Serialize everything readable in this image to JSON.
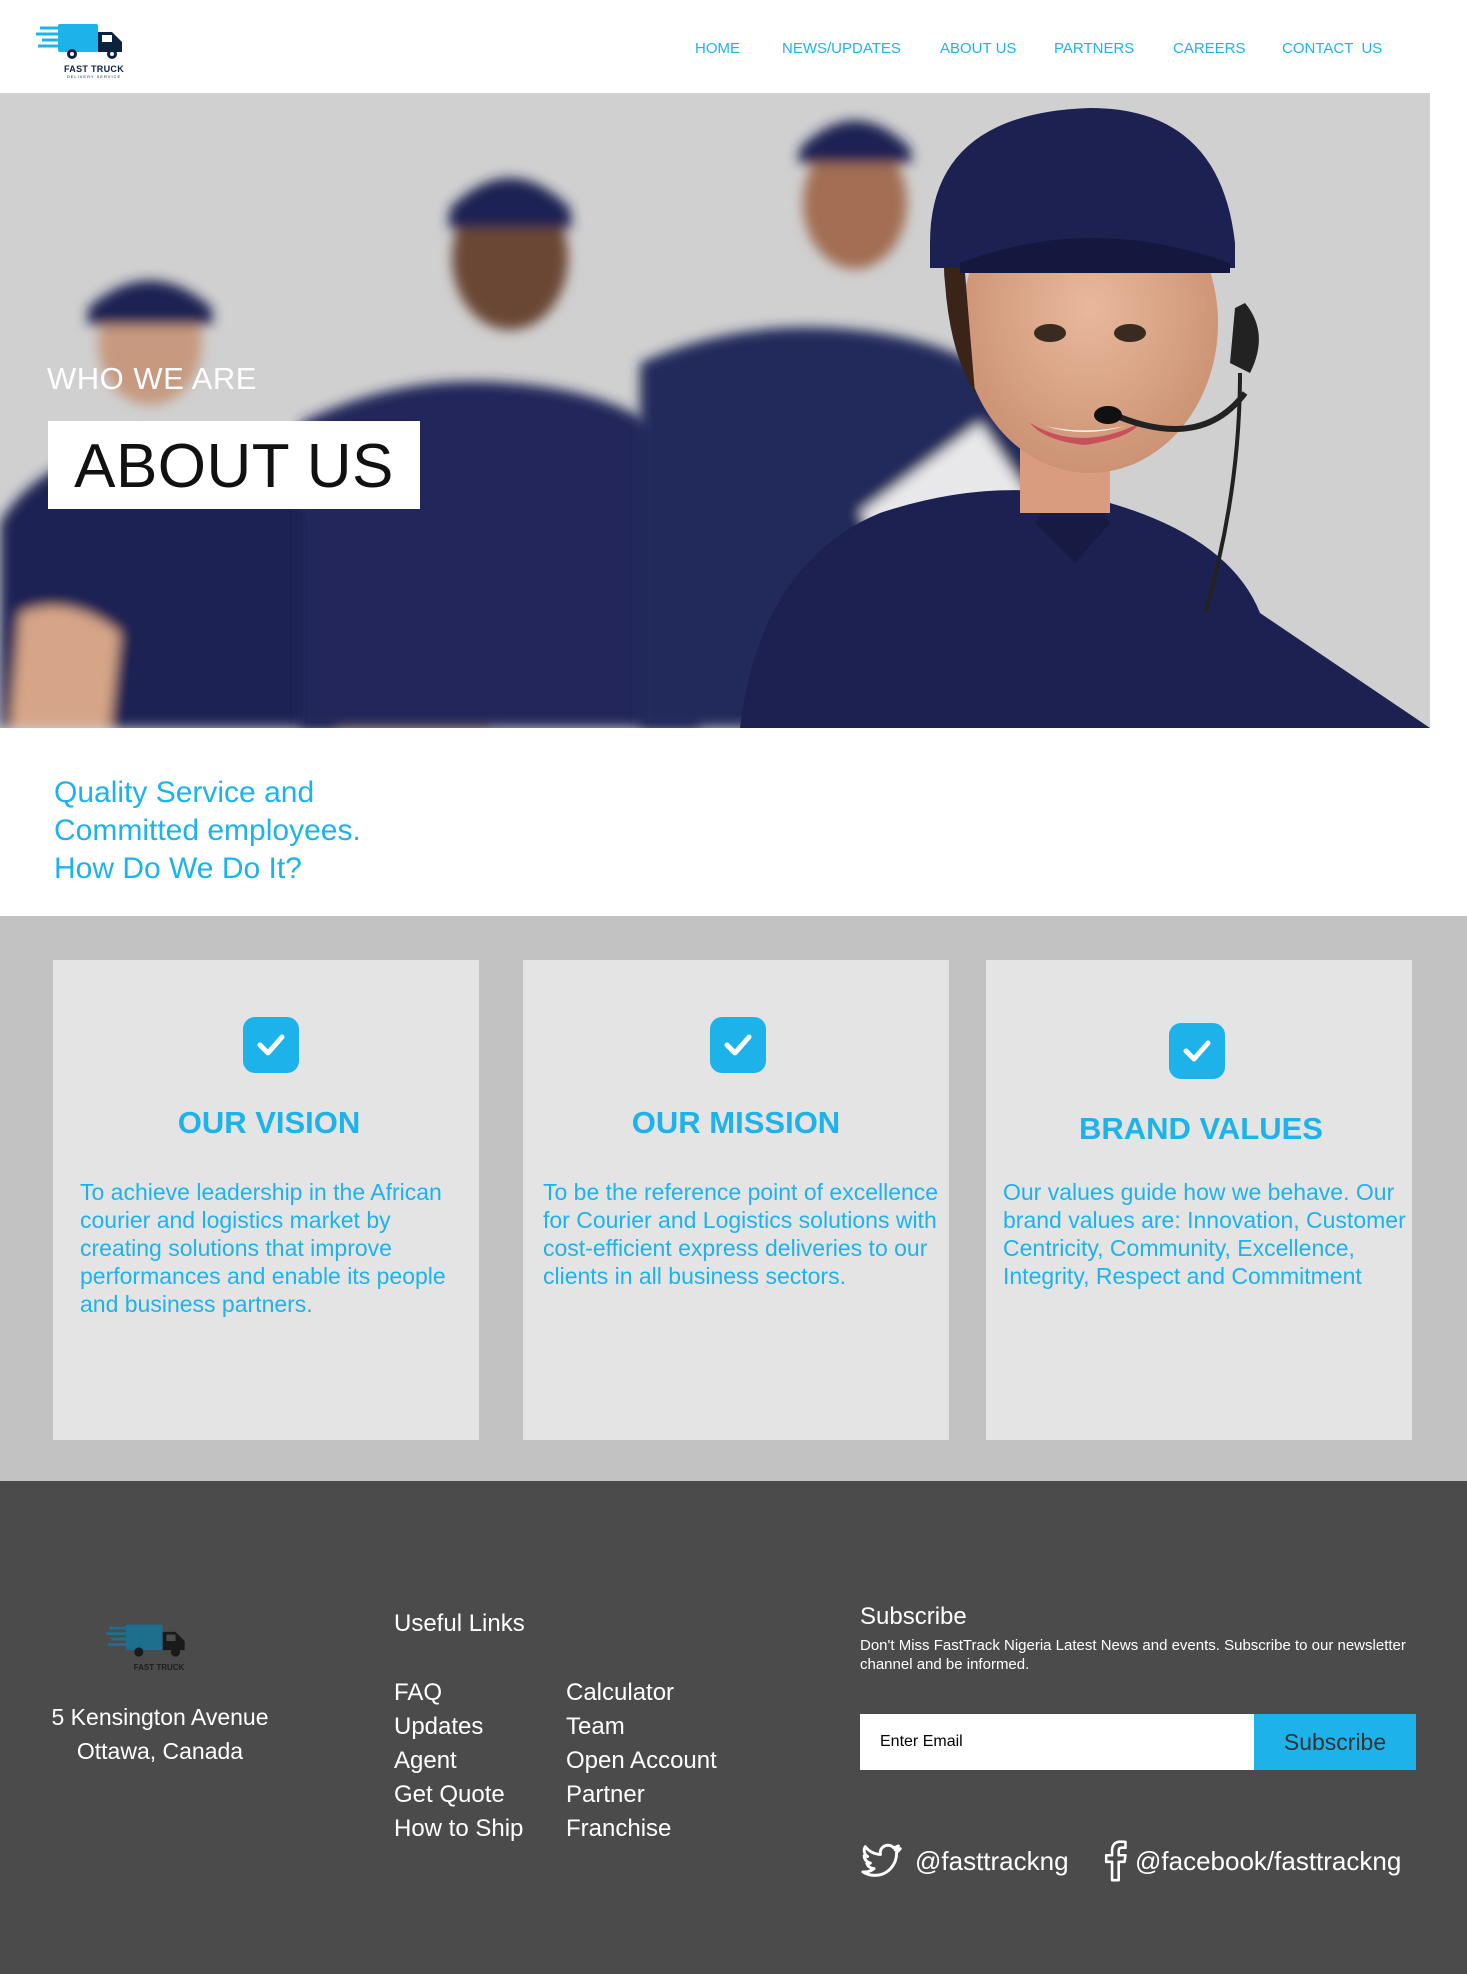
{
  "brand": {
    "logo_text": "FAST TRUCK",
    "logo_subtext": "DELIVERY SERVICE"
  },
  "nav": {
    "items": [
      "HOME",
      "NEWS/UPDATES",
      "ABOUT US",
      "PARTNERS",
      "CAREERS",
      "CONTACT  US"
    ]
  },
  "hero": {
    "eyebrow": "WHO WE ARE",
    "title": "ABOUT US"
  },
  "intro": {
    "lines": [
      "Quality Service and",
      "Committed employees.",
      "How Do We Do It?"
    ]
  },
  "cards": [
    {
      "title": "OUR VISION",
      "body": "To achieve leadership in the African courier and logistics market by creating solutions that improve performances and enable its people and business partners."
    },
    {
      "title": "OUR MISSION",
      "body": "To be the reference point of excellence for Courier and Logistics solutions with cost-efficient express deliveries to our clients in all business sectors."
    },
    {
      "title": "BRAND VALUES",
      "body": "Our values guide how we behave. Our brand values are: Innovation, Customer Centricity, Community, Excellence, Integrity, Respect and Commitment"
    }
  ],
  "footer": {
    "address": [
      "5 Kensington Avenue",
      "Ottawa, Canada"
    ],
    "useful_links_title": "Useful Links",
    "links_col1": [
      "FAQ",
      "Updates",
      "Agent",
      "Get Quote",
      "How to Ship"
    ],
    "links_col2": [
      "Calculator",
      "Team",
      "Open Account",
      "Partner",
      "Franchise"
    ],
    "subscribe": {
      "title": "Subscribe",
      "description": "Don't Miss FastTrack Nigeria Latest News and events. Subscribe to our newsletter channel and be informed.",
      "email_placeholder": "Enter Email",
      "button_label": "Subscribe"
    },
    "social": {
      "twitter_handle": "@fasttrackng",
      "facebook_handle": "@facebook/fasttrackng"
    }
  },
  "colors": {
    "accent": "#1db3ea",
    "navy": "#1c2152",
    "footer_bg": "#4b4b4b",
    "cards_bg": "#c2c2c2",
    "card_bg": "#e4e4e4"
  }
}
